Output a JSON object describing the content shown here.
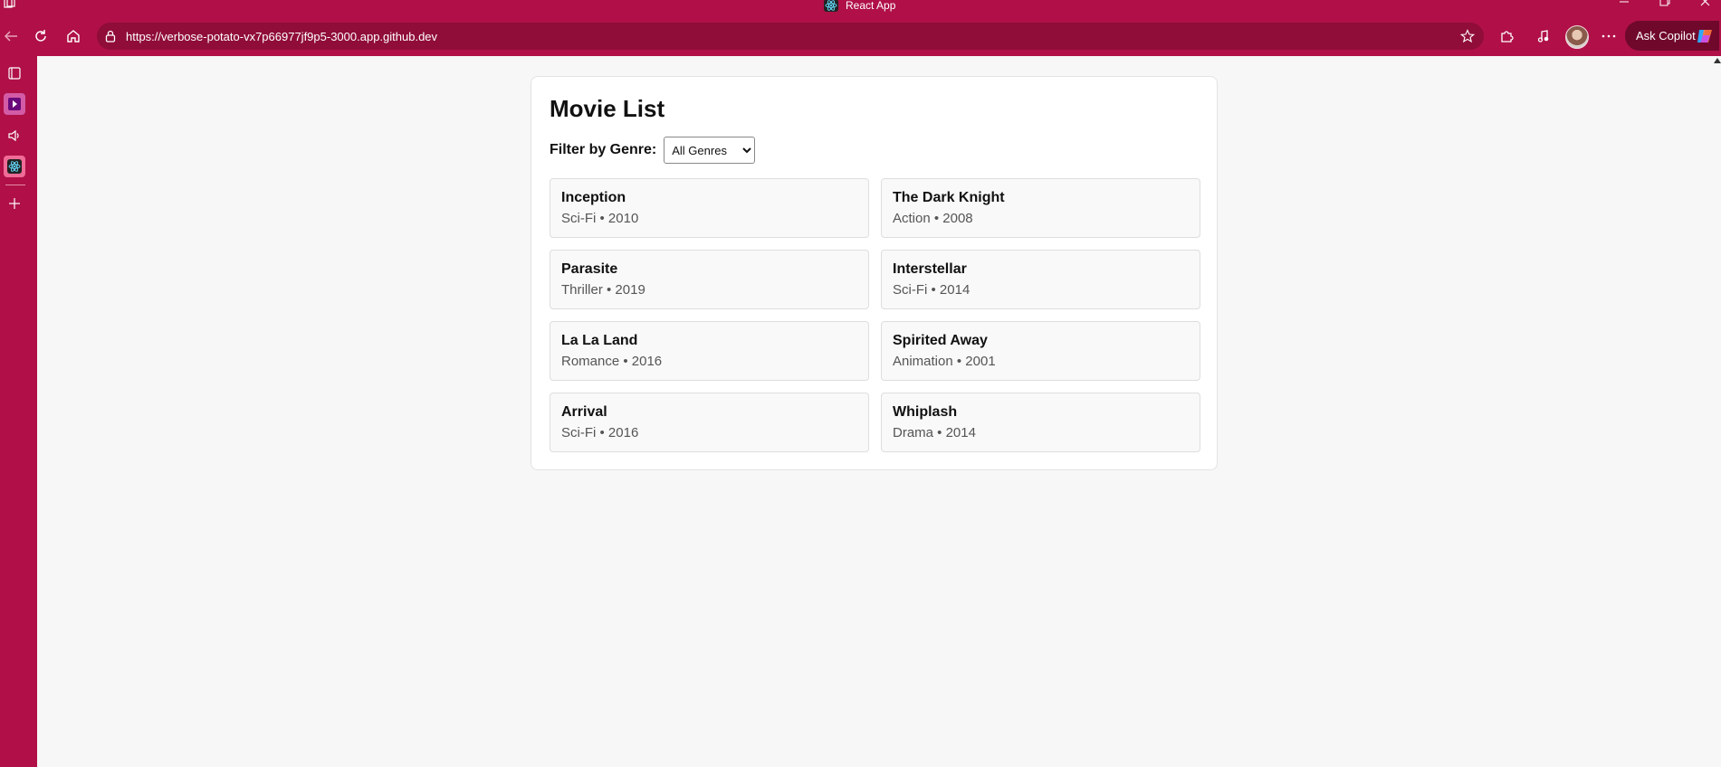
{
  "window": {
    "title": "React App"
  },
  "browser": {
    "url": "https://verbose-potato-vx7p66977jf9p5-3000.app.github.dev",
    "copilot_label": "Ask Copilot"
  },
  "app": {
    "title": "Movie List",
    "filter_label": "Filter by Genre:",
    "genre_selected": "All Genres",
    "movies": [
      {
        "title": "Inception",
        "genre": "Sci-Fi",
        "year": "2010",
        "meta": "Sci-Fi • 2010"
      },
      {
        "title": "The Dark Knight",
        "genre": "Action",
        "year": "2008",
        "meta": "Action • 2008"
      },
      {
        "title": "Parasite",
        "genre": "Thriller",
        "year": "2019",
        "meta": "Thriller • 2019"
      },
      {
        "title": "Interstellar",
        "genre": "Sci-Fi",
        "year": "2014",
        "meta": "Sci-Fi • 2014"
      },
      {
        "title": "La La Land",
        "genre": "Romance",
        "year": "2016",
        "meta": "Romance • 2016"
      },
      {
        "title": "Spirited Away",
        "genre": "Animation",
        "year": "2001",
        "meta": "Animation • 2001"
      },
      {
        "title": "Arrival",
        "genre": "Sci-Fi",
        "year": "2016",
        "meta": "Sci-Fi • 2016"
      },
      {
        "title": "Whiplash",
        "genre": "Drama",
        "year": "2014",
        "meta": "Drama • 2014"
      }
    ]
  },
  "colors": {
    "chrome": "#b01047",
    "address_bar": "#900c39",
    "page_bg": "#f7f7f7"
  },
  "icons": {
    "tabs_icon": "tabs-icon",
    "back": "back-arrow-icon",
    "refresh": "refresh-icon",
    "home": "home-icon",
    "lock": "lock-icon",
    "star": "star-icon",
    "extensions": "puzzle-icon",
    "media": "music-note-icon",
    "more": "more-icon",
    "sidebar": [
      "tab-icon",
      "play-icon",
      "speaker-icon",
      "react-icon",
      "plus-icon"
    ]
  }
}
